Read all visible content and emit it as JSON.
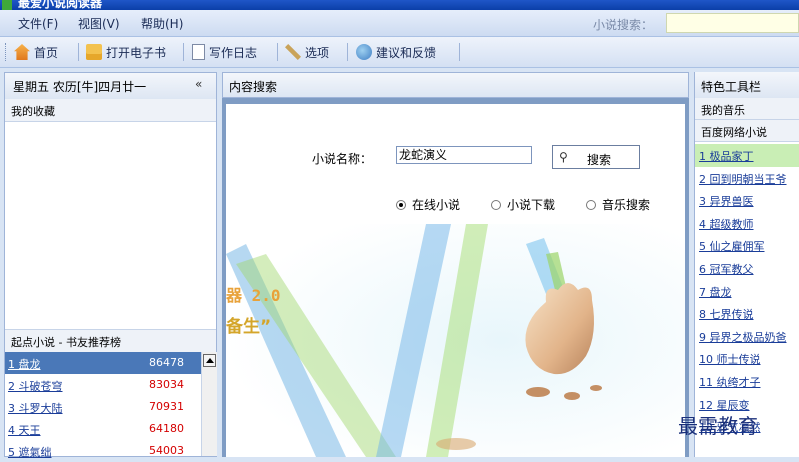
{
  "window": {
    "title": "最爱小说阅读器"
  },
  "menu": {
    "items": [
      "文件(F)",
      "视图(V)",
      "帮助(H)"
    ],
    "search_label": "小说搜索：",
    "search_value": ""
  },
  "toolbar": {
    "home": "首页",
    "open_ebook": "打开电子书",
    "write_diary": "写作日志",
    "options": "选项",
    "feedback": "建议和反馈"
  },
  "left": {
    "date": "星期五  农历[牛]四月廿一",
    "collapse": "«",
    "favorites_title": "我的收藏",
    "ranking_title": "起点小说 - 书友推荐榜",
    "ranking": [
      {
        "name": "1 盘龙",
        "count": "86478"
      },
      {
        "name": "2 斗破苍穹",
        "count": "83034"
      },
      {
        "name": "3 斗罗大陆",
        "count": "70931"
      },
      {
        "name": "4 天王",
        "count": "64180"
      },
      {
        "name": "5 遮氣绌",
        "count": "54003"
      }
    ]
  },
  "center": {
    "title": "内容搜索",
    "name_label": "小说名称：",
    "name_value": "龙蛇演义",
    "search_button": "搜索",
    "radios": [
      {
        "label": "在线小说",
        "selected": true
      },
      {
        "label": "小说下载",
        "selected": false
      },
      {
        "label": "音乐搜索",
        "selected": false
      }
    ],
    "logo_version": "器 2.0",
    "logo_slogan": "备生”"
  },
  "right": {
    "title": "特色工具栏",
    "music": "我的音乐",
    "baidu": "百度网络小说",
    "novels": [
      "1 极品家丁",
      "2 回到明朝当王爷",
      "3 异界兽医",
      "4 超级教师",
      "5 仙之雇佣军",
      "6 冠军教父",
      "7 盘龙",
      "8 七界传说",
      "9 异界之极品奶爸",
      "10 师士传说",
      "11 纨绔才子",
      "12 星辰变",
      "13 邪气凛然"
    ]
  },
  "watermark": "最需教育"
}
